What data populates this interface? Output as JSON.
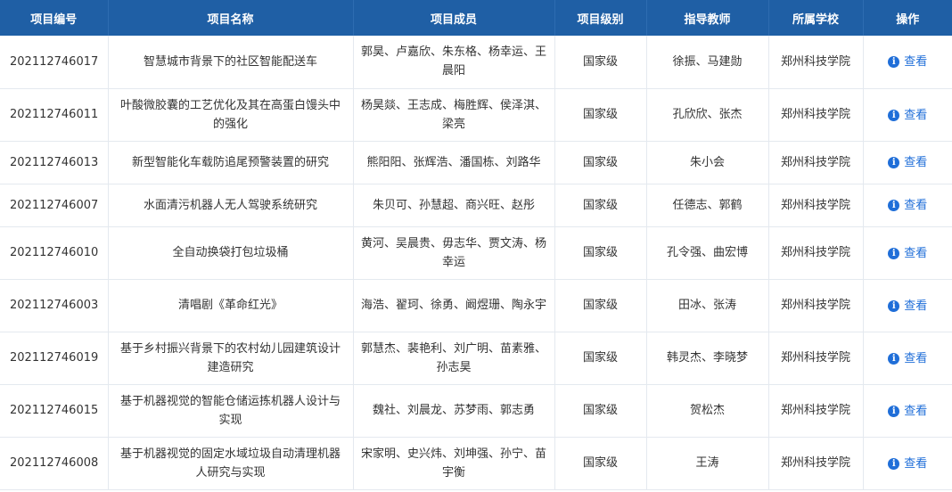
{
  "table": {
    "headers": [
      "项目编号",
      "项目名称",
      "项目成员",
      "项目级别",
      "指导教师",
      "所属学校",
      "操作"
    ],
    "action_label": "查看",
    "rows": [
      {
        "id": "202112746017",
        "name": "智慧城市背景下的社区智能配送车",
        "members": "郭昊、卢嘉欣、朱东格、杨幸运、王晨阳",
        "level": "国家级",
        "teacher": "徐振、马建勋",
        "school": "郑州科技学院"
      },
      {
        "id": "202112746011",
        "name": "叶酸微胶囊的工艺优化及其在高蛋白馒头中的强化",
        "members": "杨昊燚、王志成、梅胜辉、侯泽淇、梁亮",
        "level": "国家级",
        "teacher": "孔欣欣、张杰",
        "school": "郑州科技学院"
      },
      {
        "id": "202112746013",
        "name": "新型智能化车载防追尾预警装置的研究",
        "members": "熊阳阳、张辉浩、潘国栋、刘路华",
        "level": "国家级",
        "teacher": "朱小会",
        "school": "郑州科技学院"
      },
      {
        "id": "202112746007",
        "name": "水面清污机器人无人驾驶系统研究",
        "members": "朱贝可、孙慧超、商兴旺、赵彤",
        "level": "国家级",
        "teacher": "任德志、郭鹤",
        "school": "郑州科技学院"
      },
      {
        "id": "202112746010",
        "name": "全自动换袋打包垃圾桶",
        "members": "黄河、吴晨贵、毋志华、贾文涛、杨幸运",
        "level": "国家级",
        "teacher": "孔令强、曲宏博",
        "school": "郑州科技学院"
      },
      {
        "id": "202112746003",
        "name": "清唱剧《革命红光》",
        "members": "海浩、翟珂、徐勇、阚煜珊、陶永宇",
        "level": "国家级",
        "teacher": "田冰、张涛",
        "school": "郑州科技学院"
      },
      {
        "id": "202112746019",
        "name": "基于乡村振兴背景下的农村幼儿园建筑设计建造研究",
        "members": "郭慧杰、裴艳利、刘广明、苗素雅、孙志昊",
        "level": "国家级",
        "teacher": "韩灵杰、李晓梦",
        "school": "郑州科技学院"
      },
      {
        "id": "202112746015",
        "name": "基于机器视觉的智能仓储运拣机器人设计与实现",
        "members": "魏社、刘晨龙、苏梦雨、郭志勇",
        "level": "国家级",
        "teacher": "贺松杰",
        "school": "郑州科技学院"
      },
      {
        "id": "202112746008",
        "name": "基于机器视觉的固定水域垃圾自动清理机器人研究与实现",
        "members": "宋家明、史兴炜、刘坤强、孙宁、苗宇衡",
        "level": "国家级",
        "teacher": "王涛",
        "school": "郑州科技学院"
      }
    ]
  }
}
